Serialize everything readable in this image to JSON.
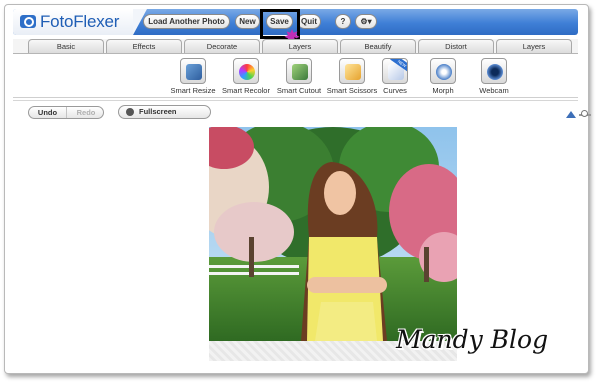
{
  "app": {
    "name": "FotoFlexer"
  },
  "topbar": {
    "load_label": "Load Another Photo",
    "new_label": "New",
    "save_label": "Save",
    "quit_label": "Quit",
    "help_label": "?",
    "settings_label": "⚙▾"
  },
  "tabs": [
    {
      "label": "Basic"
    },
    {
      "label": "Effects"
    },
    {
      "label": "Decorate"
    },
    {
      "label": "Layers"
    },
    {
      "label": "Beautify"
    },
    {
      "label": "Distort"
    },
    {
      "label": "Layers"
    }
  ],
  "tools": [
    {
      "label": "Smart Resize",
      "icon": "smart-resize-icon"
    },
    {
      "label": "Smart Recolor",
      "icon": "smart-recolor-icon"
    },
    {
      "label": "Smart Cutout",
      "icon": "smart-cutout-icon"
    },
    {
      "label": "Smart Scissors",
      "icon": "smart-scissors-icon"
    },
    {
      "label": "Curves",
      "icon": "curves-icon",
      "badge": "NEW"
    },
    {
      "label": "Morph",
      "icon": "morph-icon"
    },
    {
      "label": "Webcam",
      "icon": "webcam-icon"
    }
  ],
  "history": {
    "undo_label": "Undo",
    "redo_label": "Redo"
  },
  "view": {
    "fullscreen_label": "Fullscreen"
  },
  "watermark": {
    "text": "Mandy Blog"
  },
  "colors": {
    "accent": "#3f7fd6",
    "highlight": "#000000",
    "starburst": "#c12fb8"
  }
}
